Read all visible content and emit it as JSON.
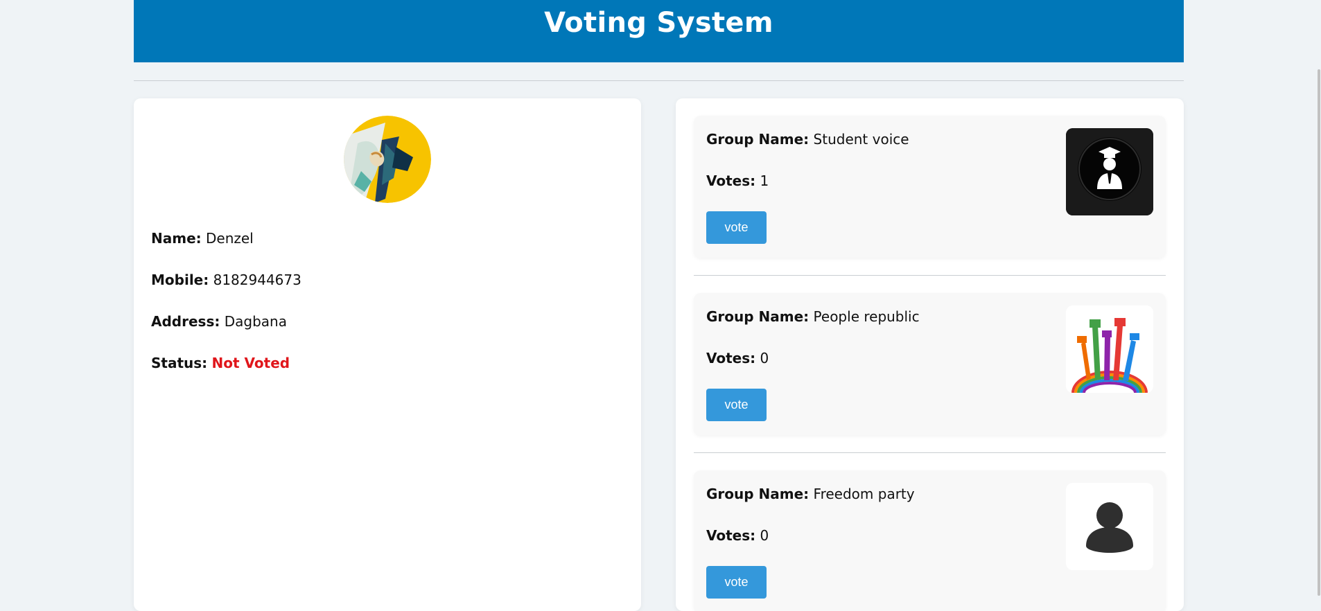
{
  "header": {
    "title": "Voting System"
  },
  "profile": {
    "avatar_icon": "user-avatar-illustration",
    "name_label": "Name:",
    "name_value": "Denzel",
    "mobile_label": "Mobile:",
    "mobile_value": "8182944673",
    "address_label": "Address:",
    "address_value": "Dagbana",
    "status_label": "Status:",
    "status_value": "Not Voted",
    "status_color": "#e0161b"
  },
  "groups": [
    {
      "name_label": "Group Name:",
      "name": "Student voice",
      "votes_label": "Votes:",
      "votes": "1",
      "button": "vote",
      "logo_icon": "graduate-icon"
    },
    {
      "name_label": "Group Name:",
      "name": "People republic",
      "votes_label": "Votes:",
      "votes": "0",
      "button": "vote",
      "logo_icon": "raised-hands-icon"
    },
    {
      "name_label": "Group Name:",
      "name": "Freedom party",
      "votes_label": "Votes:",
      "votes": "0",
      "button": "vote",
      "logo_icon": "person-silhouette-icon"
    }
  ],
  "colors": {
    "header_bg": "#0077b8",
    "button_bg": "#3498db",
    "page_bg": "#eff3f6"
  }
}
